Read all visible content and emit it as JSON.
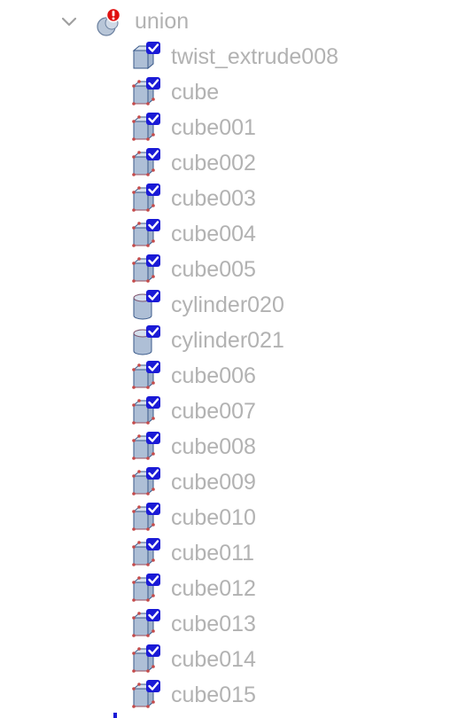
{
  "root": {
    "label": "union",
    "expanded": true,
    "icon": "union-error-icon"
  },
  "children": [
    {
      "label": "twist_extrude008",
      "icon": "extrude-icon"
    },
    {
      "label": "cube",
      "icon": "cube-icon"
    },
    {
      "label": "cube001",
      "icon": "cube-icon"
    },
    {
      "label": "cube002",
      "icon": "cube-icon"
    },
    {
      "label": "cube003",
      "icon": "cube-icon"
    },
    {
      "label": "cube004",
      "icon": "cube-icon"
    },
    {
      "label": "cube005",
      "icon": "cube-icon"
    },
    {
      "label": "cylinder020",
      "icon": "cylinder-icon"
    },
    {
      "label": "cylinder021",
      "icon": "cylinder-icon"
    },
    {
      "label": "cube006",
      "icon": "cube-icon"
    },
    {
      "label": "cube007",
      "icon": "cube-icon"
    },
    {
      "label": "cube008",
      "icon": "cube-icon"
    },
    {
      "label": "cube009",
      "icon": "cube-icon"
    },
    {
      "label": "cube010",
      "icon": "cube-icon"
    },
    {
      "label": "cube011",
      "icon": "cube-icon"
    },
    {
      "label": "cube012",
      "icon": "cube-icon"
    },
    {
      "label": "cube013",
      "icon": "cube-icon"
    },
    {
      "label": "cube014",
      "icon": "cube-icon"
    },
    {
      "label": "cube015",
      "icon": "cube-icon"
    }
  ],
  "colors": {
    "label": "#b2b2b2",
    "check": "#1a1ad6",
    "cube_face": "#aebfd6",
    "cube_edge": "#3a5a8a",
    "vertex": "#c44a4a",
    "error": "#e01010"
  }
}
